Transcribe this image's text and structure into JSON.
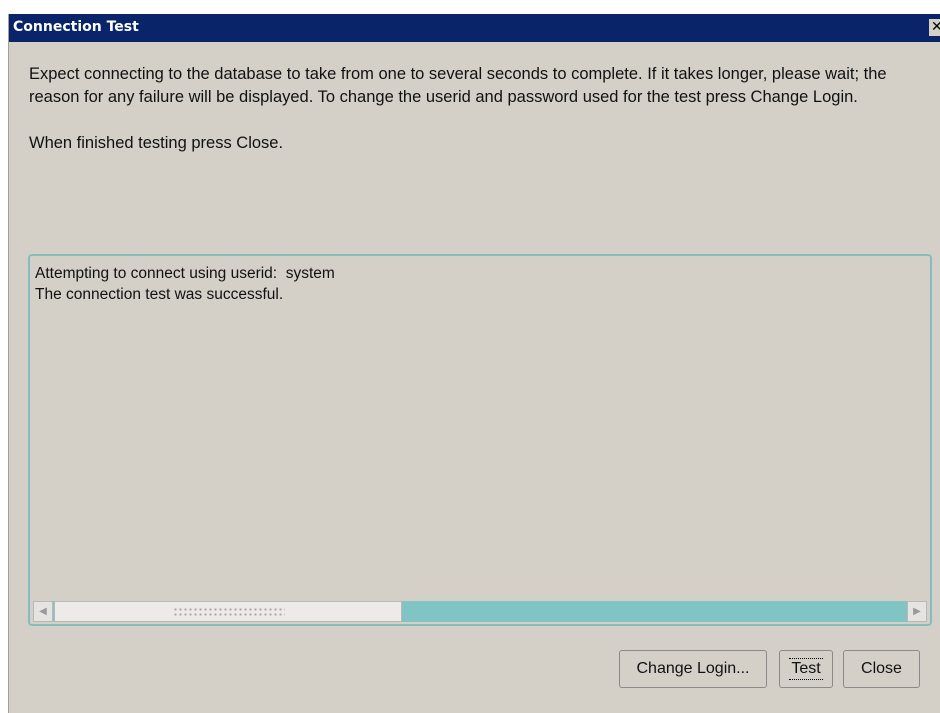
{
  "window": {
    "title": "Connection Test",
    "close_glyph": "✕"
  },
  "instructions": {
    "paragraph1": "Expect connecting to the database to take from one to several seconds to complete. If it takes longer, please wait; the reason for any failure will be displayed. To change the userid and password used for the test press Change Login.",
    "paragraph2": "When finished testing press Close."
  },
  "output": {
    "lines": [
      "Attempting to connect using userid:  system",
      "The connection test was successful."
    ]
  },
  "scrollbar": {
    "left_arrow": "◀",
    "right_arrow": "▶"
  },
  "buttons": {
    "change_login": "Change Login...",
    "test": "Test",
    "close": "Close"
  },
  "colors": {
    "titlebar": "#0a246a",
    "dialog_background": "#d4d0c8",
    "panel_border": "#88bcbc",
    "scroll_track": "#80c4c4"
  }
}
